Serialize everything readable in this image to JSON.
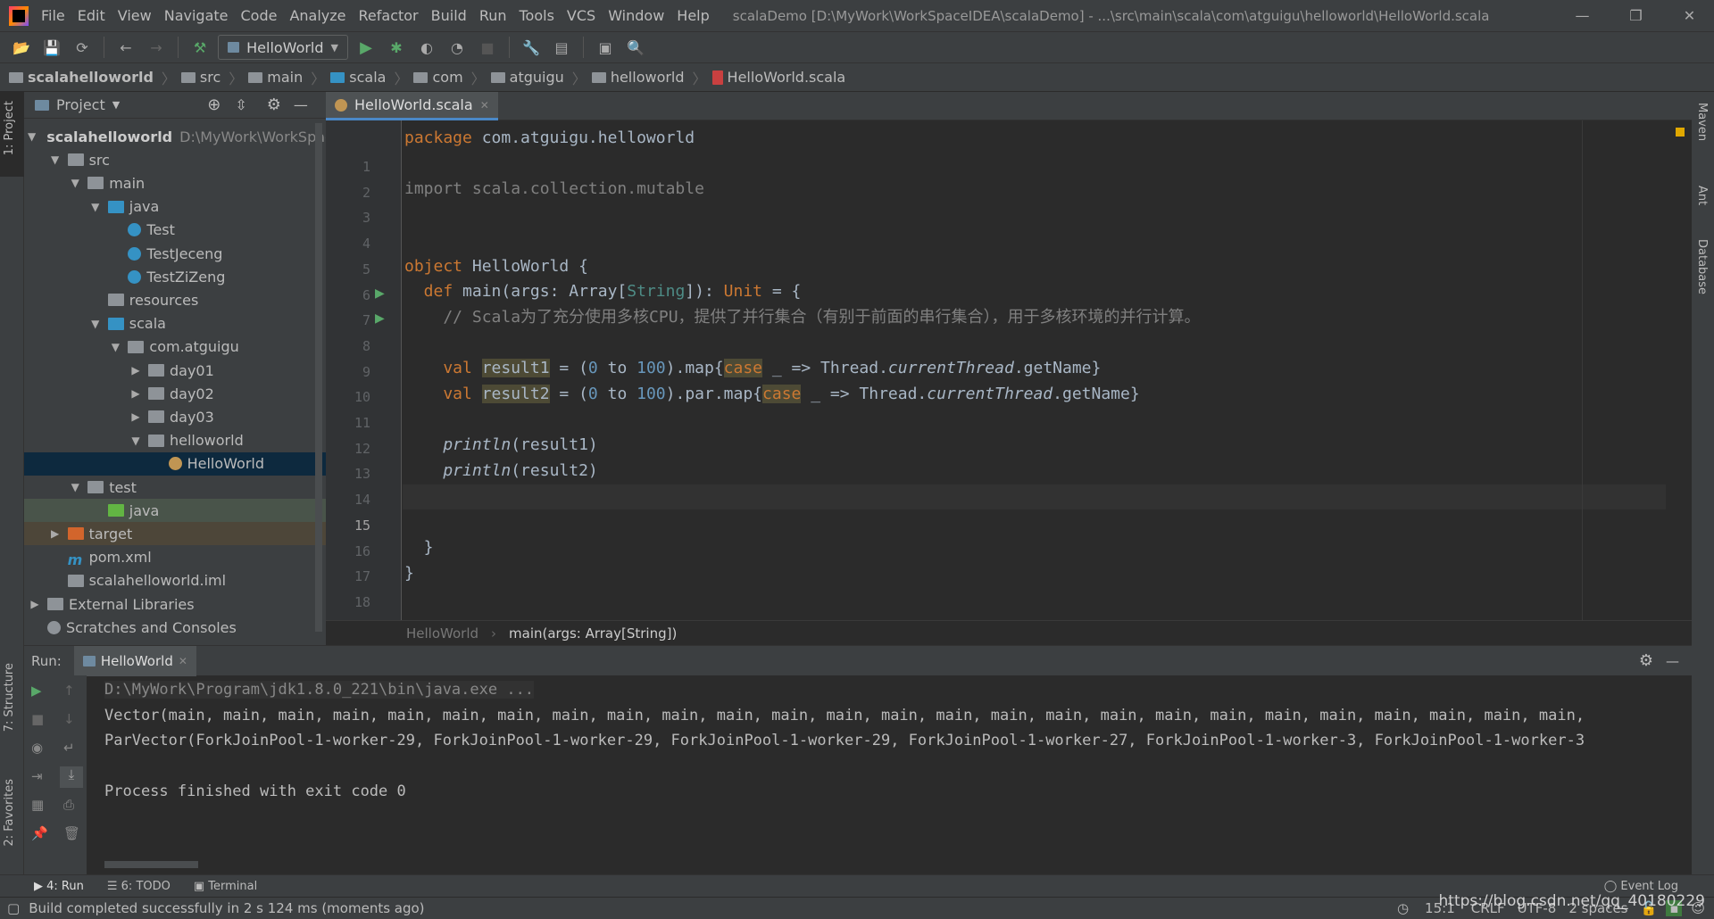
{
  "window": {
    "title": "scalaDemo [D:\\MyWork\\WorkSpaceIDEA\\scalaDemo] - ...\\src\\main\\scala\\com\\atguigu\\helloworld\\HelloWorld.scala"
  },
  "menu": [
    "File",
    "Edit",
    "View",
    "Navigate",
    "Code",
    "Analyze",
    "Refactor",
    "Build",
    "Run",
    "Tools",
    "VCS",
    "Window",
    "Help"
  ],
  "toolbar": {
    "run_config": "HelloWorld"
  },
  "breadcrumb": [
    "scalahelloworld",
    "src",
    "main",
    "scala",
    "com",
    "atguigu",
    "helloworld",
    "HelloWorld.scala"
  ],
  "left_strip": {
    "project": "1: Project",
    "structure": "7: Structure",
    "favorites": "2: Favorites"
  },
  "right_strip": {
    "maven": "Maven",
    "ant": "Ant",
    "database": "Database"
  },
  "project": {
    "header": "Project",
    "tree": [
      {
        "label": "scalahelloworld",
        "extra": "D:\\MyWork\\WorkSpaceIDEA",
        "depth": 0,
        "arrow": "down",
        "icon": "module-folder",
        "bold": true
      },
      {
        "label": "src",
        "depth": 1,
        "arrow": "down",
        "icon": "folder"
      },
      {
        "label": "main",
        "depth": 2,
        "arrow": "down",
        "icon": "folder"
      },
      {
        "label": "java",
        "depth": 3,
        "arrow": "down",
        "icon": "source-folder"
      },
      {
        "label": "Test",
        "depth": 4,
        "icon": "java-class"
      },
      {
        "label": "TestJeceng",
        "depth": 4,
        "icon": "java-class"
      },
      {
        "label": "TestZiZeng",
        "depth": 4,
        "icon": "java-class"
      },
      {
        "label": "resources",
        "depth": 3,
        "icon": "resources-folder"
      },
      {
        "label": "scala",
        "depth": 3,
        "arrow": "down",
        "icon": "source-folder"
      },
      {
        "label": "com.atguigu",
        "depth": 4,
        "arrow": "down",
        "icon": "package"
      },
      {
        "label": "day01",
        "depth": 5,
        "arrow": "right",
        "icon": "package"
      },
      {
        "label": "day02",
        "depth": 5,
        "arrow": "right",
        "icon": "package"
      },
      {
        "label": "day03",
        "depth": 5,
        "arrow": "right",
        "icon": "package"
      },
      {
        "label": "helloworld",
        "depth": 5,
        "arrow": "down",
        "icon": "package"
      },
      {
        "label": "HelloWorld",
        "depth": 6,
        "icon": "scala-object",
        "selected": true
      },
      {
        "label": "test",
        "depth": 2,
        "arrow": "down",
        "icon": "folder"
      },
      {
        "label": "java",
        "depth": 3,
        "icon": "test-folder",
        "row_bg": "#49544a"
      },
      {
        "label": "target",
        "depth": 1,
        "arrow": "right",
        "icon": "excluded-folder",
        "row_bg": "#4d4639"
      },
      {
        "label": "pom.xml",
        "depth": 1,
        "icon": "maven-file"
      },
      {
        "label": "scalahelloworld.iml",
        "depth": 1,
        "icon": "iml-file"
      },
      {
        "label": "External Libraries",
        "depth": 0,
        "arrow": "right",
        "icon": "libraries"
      },
      {
        "label": "Scratches and Consoles",
        "depth": 0,
        "icon": "scratches"
      }
    ]
  },
  "editor": {
    "tab": "HelloWorld.scala",
    "current_line": 15,
    "lines": [
      [
        [
          "kw",
          "package "
        ],
        [
          "",
          "com.atguigu.helloworld"
        ]
      ],
      [],
      [
        [
          "cm2",
          "import scala.collection.mutable"
        ]
      ],
      [],
      [],
      [
        [
          "kw",
          "object "
        ],
        [
          "",
          "HelloWorld {"
        ]
      ],
      [
        [
          "kw",
          "  def "
        ],
        [
          "",
          "main(args: Array["
        ],
        [
          "ty",
          "String"
        ],
        [
          "",
          "]): "
        ],
        [
          "kw",
          "Unit"
        ],
        [
          "",
          " = {"
        ]
      ],
      [
        [
          "cm",
          "    // Scala为了充分使用多核CPU，提供了并行集合（有别于前面的串行集合），用于多核环境的并行计算。"
        ]
      ],
      [],
      [
        [
          "kw",
          "    val "
        ],
        [
          "hl",
          "result1"
        ],
        [
          "",
          " = ("
        ],
        [
          "num",
          "0"
        ],
        [
          "",
          " to "
        ],
        [
          "num",
          "100"
        ],
        [
          "",
          ").map{"
        ],
        [
          "kwhl",
          "case"
        ],
        [
          "",
          " _ => Thread."
        ],
        [
          "it",
          "currentThread"
        ],
        [
          "",
          ".getName}"
        ]
      ],
      [
        [
          "kw",
          "    val "
        ],
        [
          "hl",
          "result2"
        ],
        [
          "",
          " = ("
        ],
        [
          "num",
          "0"
        ],
        [
          "",
          " to "
        ],
        [
          "num",
          "100"
        ],
        [
          "",
          ").par.map{"
        ],
        [
          "kwhl",
          "case"
        ],
        [
          "",
          " _ => Thread."
        ],
        [
          "it",
          "currentThread"
        ],
        [
          "",
          ".getName}"
        ]
      ],
      [],
      [
        [
          "it",
          "    println"
        ],
        [
          "",
          "(result1)"
        ]
      ],
      [
        [
          "it",
          "    println"
        ],
        [
          "",
          "(result2)"
        ]
      ],
      [],
      [],
      [
        [
          "",
          "  }"
        ]
      ],
      [
        [
          "",
          "}"
        ]
      ],
      []
    ],
    "breadcrumb": [
      "HelloWorld",
      "main(args: Array[String])"
    ]
  },
  "run": {
    "label": "Run:",
    "tab": "HelloWorld",
    "console": [
      "D:\\MyWork\\Program\\jdk1.8.0_221\\bin\\java.exe ...",
      "Vector(main, main, main, main, main, main, main, main, main, main, main, main, main, main, main, main, main, main, main, main, main, main, main, main, main, main,",
      "ParVector(ForkJoinPool-1-worker-29, ForkJoinPool-1-worker-29, ForkJoinPool-1-worker-29, ForkJoinPool-1-worker-27, ForkJoinPool-1-worker-3, ForkJoinPool-1-worker-3",
      "",
      "Process finished with exit code 0"
    ]
  },
  "bottom_tabs": {
    "run": "4: Run",
    "todo": "6: TODO",
    "terminal": "Terminal",
    "event_log": "Event Log"
  },
  "status": {
    "message": "Build completed successfully in 2 s 124 ms (moments ago)",
    "position": "15:1",
    "line_sep": "CRLF",
    "encoding": "UTF-8",
    "indent": "2 spaces",
    "watermark": "https://blog.csdn.net/qq_40180229"
  }
}
